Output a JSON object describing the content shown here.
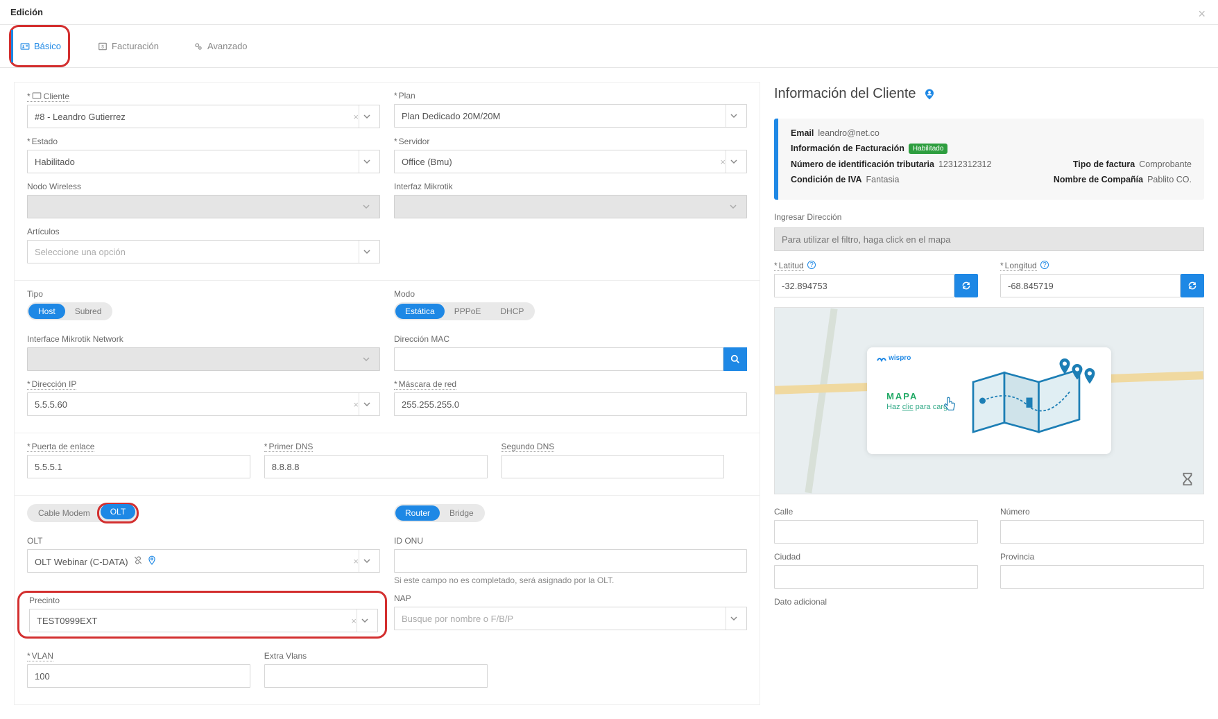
{
  "modal": {
    "title": "Edición"
  },
  "tabs": {
    "basic": "Básico",
    "billing": "Facturación",
    "advanced": "Avanzado"
  },
  "labels": {
    "cliente": "Cliente",
    "plan": "Plan",
    "estado": "Estado",
    "servidor": "Servidor",
    "nodo": "Nodo Wireless",
    "interfaz_mk": "Interfaz Mikrotik",
    "articulos": "Artículos",
    "tipo": "Tipo",
    "modo": "Modo",
    "interface_mk_net": "Interface Mikrotik Network",
    "mac": "Dirección MAC",
    "ip": "Dirección IP",
    "mascara": "Máscara de red",
    "puerta": "Puerta de enlace",
    "dns1": "Primer DNS",
    "dns2": "Segundo DNS",
    "olt": "OLT",
    "id_onu": "ID ONU",
    "precinto": "Precinto",
    "nap": "NAP",
    "vlan": "VLAN",
    "extra_vlans": "Extra Vlans",
    "id_onu_hint": "Si este campo no es completado, será asignado por la OLT.",
    "info_cliente": "Información del Cliente",
    "ingresar_dir": "Ingresar Dirección",
    "filtro_hint": "Para utilizar el filtro, haga click en el mapa",
    "latitud": "Latitud",
    "longitud": "Longitud",
    "calle": "Calle",
    "numero": "Número",
    "ciudad": "Ciudad",
    "provincia": "Provincia",
    "dato_adicional": "Dato adicional"
  },
  "values": {
    "cliente": "#8 - Leandro Gutierrez",
    "plan": "Plan Dedicado 20M/20M",
    "estado": "Habilitado",
    "servidor": "Office (Bmu)",
    "articulos_placeholder": "Seleccione una opción",
    "ip": "5.5.5.60",
    "mascara": "255.255.255.0",
    "puerta": "5.5.5.1",
    "dns1": "8.8.8.8",
    "olt": "OLT Webinar (C-DATA)",
    "precinto": "TEST0999EXT",
    "nap_placeholder": "Busque por nombre o F/B/P",
    "vlan": "100",
    "latitud": "-32.894753",
    "longitud": "-68.845719"
  },
  "pills": {
    "tipo": {
      "host": "Host",
      "subred": "Subred"
    },
    "modo": {
      "estatica": "Estática",
      "pppoe": "PPPoE",
      "dhcp": "DHCP"
    },
    "device": {
      "cablemodem": "Cable Modem",
      "olt": "OLT"
    },
    "mode2": {
      "router": "Router",
      "bridge": "Bridge"
    }
  },
  "client_info": {
    "email_k": "Email",
    "email_v": "leandro@net.co",
    "billing_info": "Información de Facturación",
    "badge": "Habilitado",
    "tax_id_k": "Número de identificación tributaria",
    "tax_id_v": "12312312312",
    "invoice_type_k": "Tipo de factura",
    "invoice_type_v": "Comprobante",
    "iva_k": "Condición de IVA",
    "iva_v": "Fantasia",
    "company_k": "Nombre de Compañía",
    "company_v": "Pablito CO."
  },
  "map": {
    "title": "MAPA",
    "sub_pre": "Haz ",
    "sub_clic": "clic",
    "sub_post": " para cargar",
    "logo": "wispro"
  }
}
